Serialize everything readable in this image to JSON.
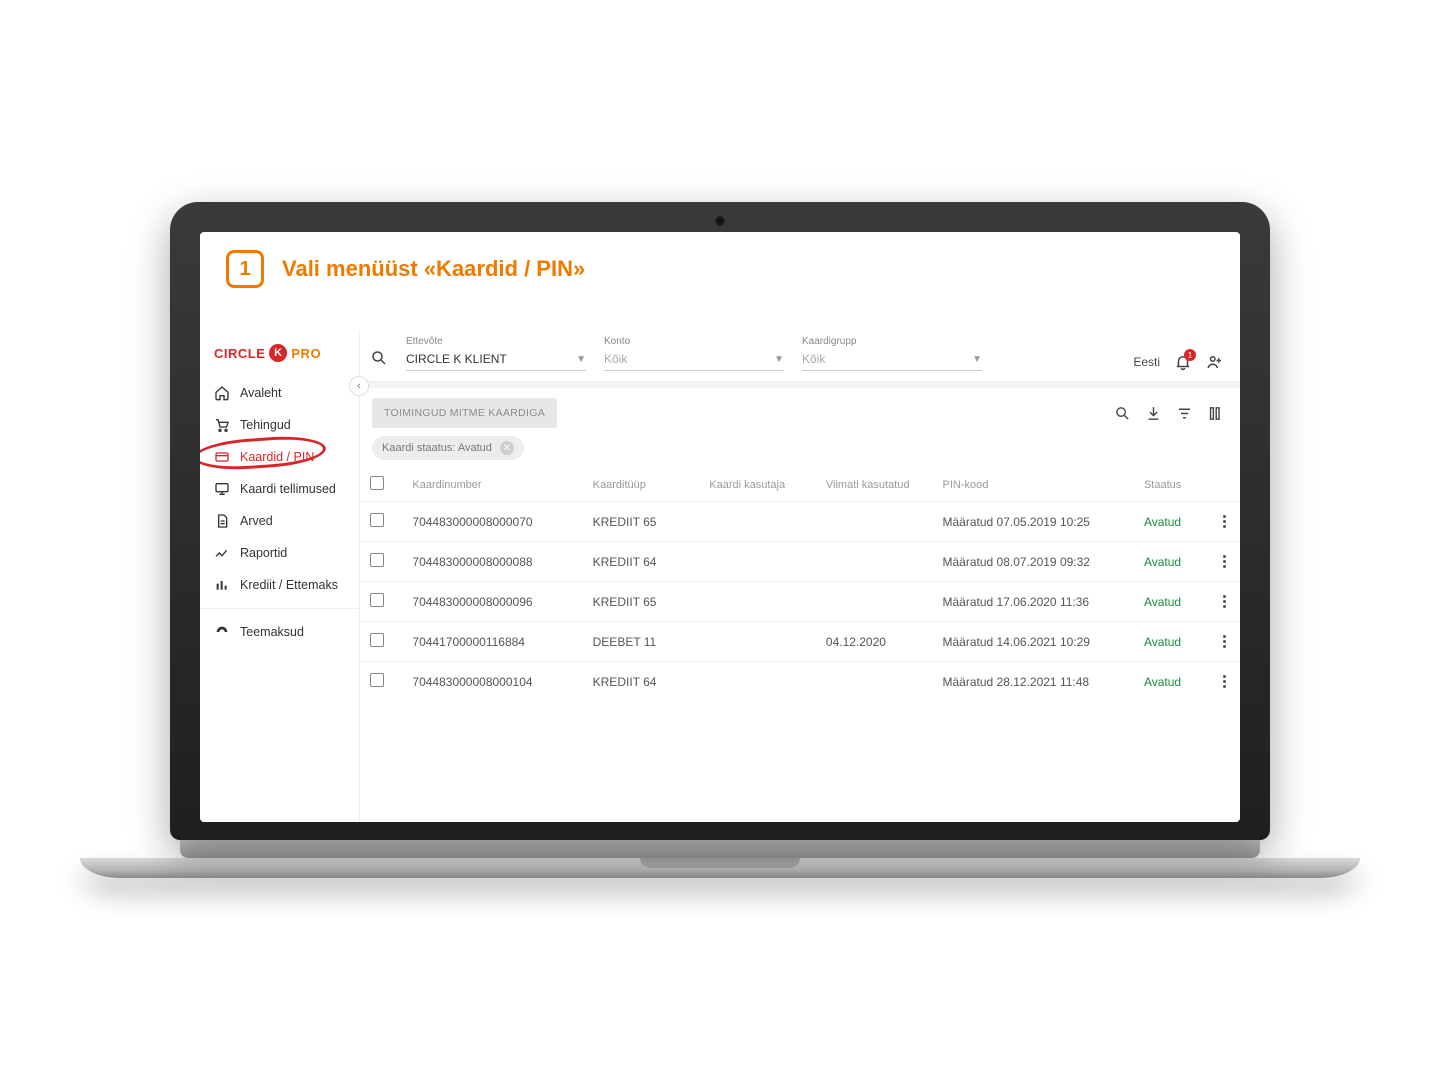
{
  "instruction": {
    "step": "1",
    "title": "Vali menüüst «Kaardid / PIN»"
  },
  "logo": {
    "word1": "CIRCLE",
    "k": "K",
    "word2": "PRO"
  },
  "sidebar": {
    "items": [
      {
        "label": "Avaleht"
      },
      {
        "label": "Tehingud"
      },
      {
        "label": "Kaardid / PIN"
      },
      {
        "label": "Kaardi tellimused"
      },
      {
        "label": "Arved"
      },
      {
        "label": "Raportid"
      },
      {
        "label": "Krediit / Ettemaks"
      },
      {
        "label": "Teemaksud"
      }
    ]
  },
  "topbar": {
    "company": {
      "label": "Ettevõte",
      "value": "CIRCLE K KLIENT"
    },
    "account": {
      "label": "Konto",
      "value": "Kõik"
    },
    "cardgroup": {
      "label": "Kaardigrupp",
      "value": "Kõik"
    },
    "language": "Eesti",
    "notif_count": "1"
  },
  "toolbar": {
    "bulk_label": "TOIMINGUD MITME KAARDIGA",
    "chip": {
      "text": "Kaardi staatus: Avatud"
    }
  },
  "table": {
    "headers": {
      "cardnum": "Kaardinumber",
      "cardtype": "Kaarditüüp",
      "user": "Kaardi kasutaja",
      "lastused": "Viimati kasutatud",
      "pin": "PIN-kood",
      "status": "Staatus"
    },
    "rows": [
      {
        "num": "704483000008000070",
        "type": "KREDIIT 65",
        "user": "",
        "last": "",
        "pin": "Määratud 07.05.2019 10:25",
        "status": "Avatud"
      },
      {
        "num": "704483000008000088",
        "type": "KREDIIT 64",
        "user": "",
        "last": "",
        "pin": "Määratud 08.07.2019 09:32",
        "status": "Avatud"
      },
      {
        "num": "704483000008000096",
        "type": "KREDIIT 65",
        "user": "",
        "last": "",
        "pin": "Määratud 17.06.2020 11:36",
        "status": "Avatud"
      },
      {
        "num": "70441700000116884",
        "type": "DEEBET 11",
        "user": "",
        "last": "04.12.2020",
        "pin": "Määratud 14.06.2021 10:29",
        "status": "Avatud"
      },
      {
        "num": "704483000008000104",
        "type": "KREDIIT 64",
        "user": "",
        "last": "",
        "pin": "Määratud 28.12.2021 11:48",
        "status": "Avatud"
      }
    ]
  }
}
